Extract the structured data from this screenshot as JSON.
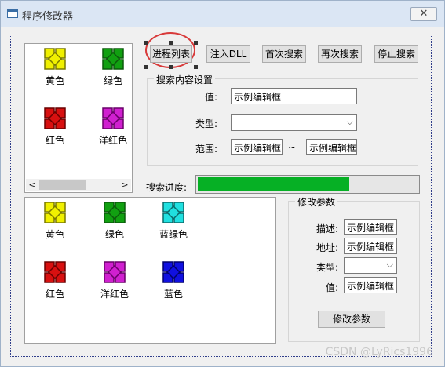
{
  "window": {
    "title": "程序修改器",
    "close": "✕"
  },
  "icon_list_1": {
    "items": [
      {
        "label": "黄色",
        "color": "#f0f000",
        "dark": "#7a7a00"
      },
      {
        "label": "绿色",
        "color": "#11a011",
        "dark": "#0b5a0b"
      },
      {
        "label": "红色",
        "color": "#d81010",
        "dark": "#6a0000"
      },
      {
        "label": "洋红色",
        "color": "#d020d0",
        "dark": "#6a006a"
      }
    ],
    "scroll_left": "<",
    "scroll_right": ">"
  },
  "toolbar": {
    "process_list": "进程列表",
    "inject_dll": "注入DLL",
    "first_search": "首次搜索",
    "search_again": "再次搜索",
    "stop_search": "停止搜索"
  },
  "search_settings": {
    "title": "搜索内容设置",
    "value_label": "值:",
    "value": "示例编辑框",
    "type_label": "类型:",
    "type_value": "",
    "range_label": "范围:",
    "range_from": "示例编辑框",
    "range_sep": "~",
    "range_to": "示例编辑框"
  },
  "progress": {
    "label": "搜索进度:",
    "value": 0.69,
    "color": "#06b025"
  },
  "icon_list_2": {
    "items": [
      {
        "label": "黄色",
        "color": "#f0f000",
        "dark": "#7a7a00"
      },
      {
        "label": "绿色",
        "color": "#11a011",
        "dark": "#0b5a0b"
      },
      {
        "label": "蓝绿色",
        "color": "#20e0e0",
        "dark": "#0a6a6a"
      },
      {
        "label": "红色",
        "color": "#d81010",
        "dark": "#6a0000"
      },
      {
        "label": "洋红色",
        "color": "#d020d0",
        "dark": "#6a006a"
      },
      {
        "label": "蓝色",
        "color": "#1010e0",
        "dark": "#00006a"
      }
    ]
  },
  "modify": {
    "title": "修改参数",
    "desc_label": "描述:",
    "desc": "示例编辑框",
    "addr_label": "地址:",
    "addr": "示例编辑框",
    "type_label": "类型:",
    "type_value": "",
    "value_label": "值:",
    "value": "示例编辑框",
    "button": "修改参数"
  },
  "watermark": "CSDN @LyRics1996"
}
